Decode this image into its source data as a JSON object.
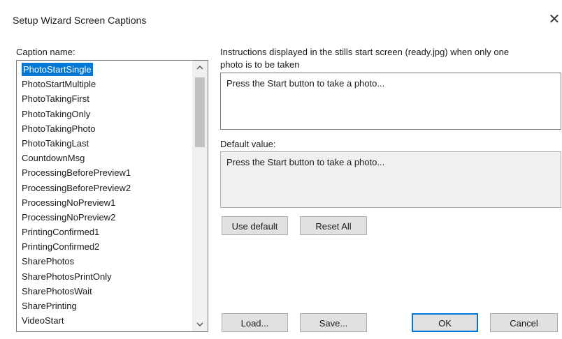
{
  "window": {
    "title": "Setup Wizard Screen Captions",
    "close_glyph": "✕"
  },
  "caption_list": {
    "label": "Caption name:",
    "selected_index": 0,
    "items": [
      "PhotoStartSingle",
      "PhotoStartMultiple",
      "PhotoTakingFirst",
      "PhotoTakingOnly",
      "PhotoTakingPhoto",
      "PhotoTakingLast",
      "CountdownMsg",
      "ProcessingBeforePreview1",
      "ProcessingBeforePreview2",
      "ProcessingNoPreview1",
      "ProcessingNoPreview2",
      "PrintingConfirmed1",
      "PrintingConfirmed2",
      "SharePhotos",
      "SharePhotosPrintOnly",
      "SharePhotosWait",
      "SharePrinting",
      "VideoStart"
    ],
    "scroll_up_glyph": "⌃",
    "scroll_down_glyph": "⌄"
  },
  "caption_editor": {
    "instructions_line1": "Instructions displayed in the stills start screen (ready.jpg) when only one",
    "instructions_line2": "photo is to be taken",
    "value": "Press the Start button to take a photo..."
  },
  "default_value": {
    "label": "Default value:",
    "value": "Press the Start button to take a photo..."
  },
  "buttons": {
    "use_default": "Use default",
    "reset_all": "Reset All",
    "load": "Load...",
    "save": "Save...",
    "ok": "OK",
    "cancel": "Cancel"
  },
  "colors": {
    "selection": "#0078d7",
    "button_face": "#e1e1e1",
    "readonly_bg": "#f0f0f0"
  }
}
